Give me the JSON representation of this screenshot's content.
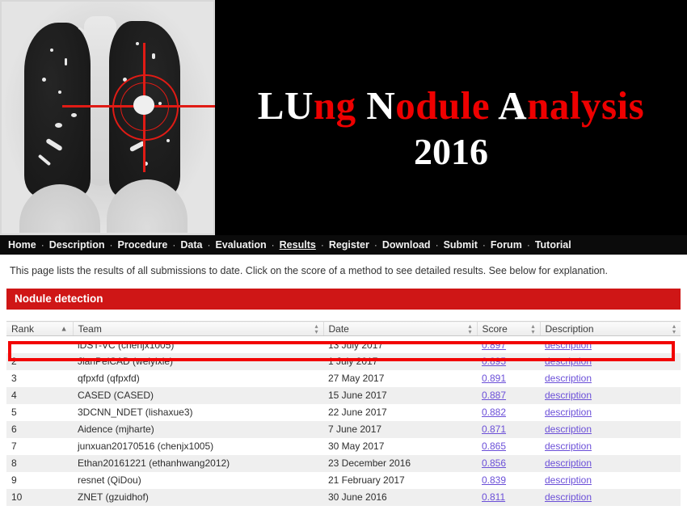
{
  "banner": {
    "ct_image_name": "coronal-chest-ct-with-nodule-crosshair",
    "title_parts": [
      {
        "text": "LU",
        "color": "white"
      },
      {
        "text": "ng ",
        "color": "red"
      },
      {
        "text": "N",
        "color": "white"
      },
      {
        "text": "odule ",
        "color": "red"
      },
      {
        "text": "A",
        "color": "white"
      },
      {
        "text": "nalysis",
        "color": "red"
      }
    ],
    "title_plain": "LUng Nodule Analysis",
    "year": "2016",
    "colors": {
      "background": "#000000",
      "accent_red": "#ee0000",
      "title_white": "#ffffff"
    }
  },
  "nav": {
    "separator": "·",
    "items": [
      {
        "label": "Home",
        "active": false
      },
      {
        "label": "Description",
        "active": false
      },
      {
        "label": "Procedure",
        "active": false
      },
      {
        "label": "Data",
        "active": false
      },
      {
        "label": "Evaluation",
        "active": false
      },
      {
        "label": "Results",
        "active": true
      },
      {
        "label": "Register",
        "active": false
      },
      {
        "label": "Download",
        "active": false
      },
      {
        "label": "Submit",
        "active": false
      },
      {
        "label": "Forum",
        "active": false
      },
      {
        "label": "Tutorial",
        "active": false
      }
    ]
  },
  "main": {
    "intro": "This page lists the results of all submissions to date. Click on the score of a method to see detailed results. See below for explanation.",
    "section_title": "Nodule detection",
    "section_color": "#cf1616",
    "table": {
      "columns": [
        {
          "label": "Rank",
          "sort": "asc"
        },
        {
          "label": "Team",
          "sort": "none"
        },
        {
          "label": "Date",
          "sort": "none"
        },
        {
          "label": "Score",
          "sort": "none"
        },
        {
          "label": "Description",
          "sort": "none"
        }
      ],
      "rows": [
        {
          "rank": "",
          "team": "iDST-VC (chenjx1005)",
          "date": "13 July 2017",
          "score": "0.897",
          "description": "description",
          "highlighted": true
        },
        {
          "rank": "2",
          "team": "JianPeiCAD (weiyixie)",
          "date": "1 July 2017",
          "score": "0.895",
          "description": "description",
          "highlighted": false
        },
        {
          "rank": "3",
          "team": "qfpxfd (qfpxfd)",
          "date": "27 May 2017",
          "score": "0.891",
          "description": "description",
          "highlighted": false
        },
        {
          "rank": "4",
          "team": "CASED (CASED)",
          "date": "15 June 2017",
          "score": "0.887",
          "description": "description",
          "highlighted": false
        },
        {
          "rank": "5",
          "team": "3DCNN_NDET (lishaxue3)",
          "date": "22 June 2017",
          "score": "0.882",
          "description": "description",
          "highlighted": false
        },
        {
          "rank": "6",
          "team": "Aidence (mjharte)",
          "date": "7 June 2017",
          "score": "0.871",
          "description": "description",
          "highlighted": false
        },
        {
          "rank": "7",
          "team": "junxuan20170516 (chenjx1005)",
          "date": "30 May 2017",
          "score": "0.865",
          "description": "description",
          "highlighted": false
        },
        {
          "rank": "8",
          "team": "Ethan20161221 (ethanhwang2012)",
          "date": "23 December 2016",
          "score": "0.856",
          "description": "description",
          "highlighted": false
        },
        {
          "rank": "9",
          "team": "resnet (QiDou)",
          "date": "21 February 2017",
          "score": "0.839",
          "description": "description",
          "highlighted": false
        },
        {
          "rank": "10",
          "team": "ZNET (gzuidhof)",
          "date": "30 June 2016",
          "score": "0.811",
          "description": "description",
          "highlighted": false
        }
      ],
      "link_color": "#6b4fd8",
      "highlight_color": "#f20505"
    }
  }
}
